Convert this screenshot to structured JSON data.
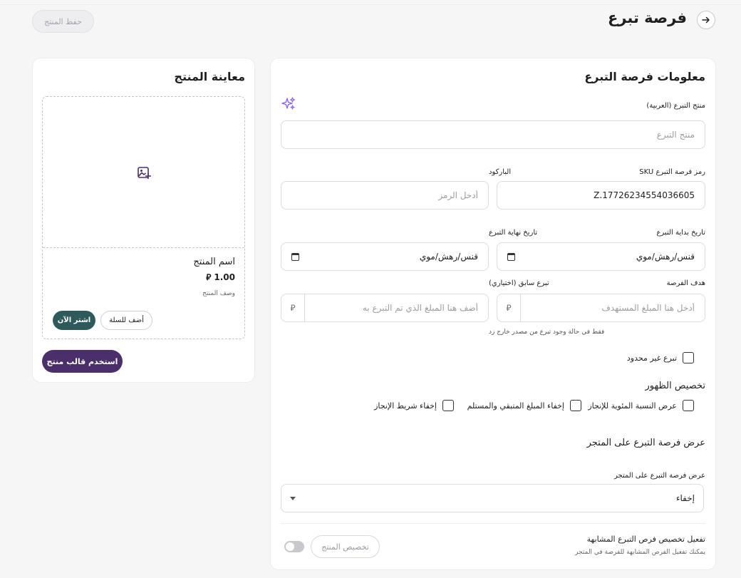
{
  "header": {
    "title": "فرصة تبرع",
    "save_label": "حفظ المنتج"
  },
  "form": {
    "section_title": "معلومات فرصة التبرع",
    "name": {
      "label": "منتج التبرع (العربية)",
      "placeholder": "منتج التبرع"
    },
    "sku": {
      "label": "رمز فرصة التبرع SKU",
      "value": "Z.17726234554036605"
    },
    "barcode": {
      "label": "الباركود",
      "placeholder": "أدخل الرمز"
    },
    "start_date": {
      "label": "تاريخ بداية التبرع",
      "value": "قنس/رهش/موي"
    },
    "end_date": {
      "label": "تاريخ نهاية التبرع",
      "value": "قنس/رهش/موي"
    },
    "goal": {
      "label": "هدف الفرصة",
      "placeholder": "أدخل هنا المبلغ المستهدف",
      "currency": "⃁"
    },
    "previous": {
      "label": "تبرع سابق (اختياري)",
      "placeholder": "أضف هنا المبلغ الذي تم التبرع به",
      "currency": "⃁",
      "hint": "فقط في حالة وجود تبرع من مصدر خارج زد"
    },
    "unlimited_label": "تبرع غير محدود",
    "display_title": "تخصيص الظهور",
    "display_options": [
      "عرض النسبة المئوية للإنجاز",
      "إخفاء المبلغ المتبقي والمستلم",
      "إخفاء شريط الإنجاز"
    ],
    "store_section_title": "عرض فرصة التبرع على المتجر",
    "store_select": {
      "label": "عرض فرصة التبرع على المتجر",
      "value": "إخفاء"
    },
    "similar": {
      "title": "تفعيل تخصيص فرص التبرع المشابهة",
      "subtitle": "يمكنك تفعيل الفرص المشابهة للفرصة في المتجر",
      "button_label": "تخصيص المنتج",
      "toggle_on": false
    }
  },
  "preview": {
    "title": "معاينة المنتج",
    "product_name": "اسم المنتج",
    "price": "1.00",
    "currency": "⃁",
    "description": "وصف المنتج",
    "add_to_cart": "أضف للسلة",
    "buy_now": "اشتر الآن",
    "use_template": "استخدم قالب منتج"
  },
  "colors": {
    "primary": "#4a2f6b",
    "buy_now": "#2f5a5c",
    "sparkle": "#8b5cf6",
    "background": "#f6f6f7"
  },
  "icons": {
    "back": "arrow-right-icon",
    "ai": "sparkle-icon",
    "image": "image-add-icon",
    "calendar": "calendar-icon"
  }
}
